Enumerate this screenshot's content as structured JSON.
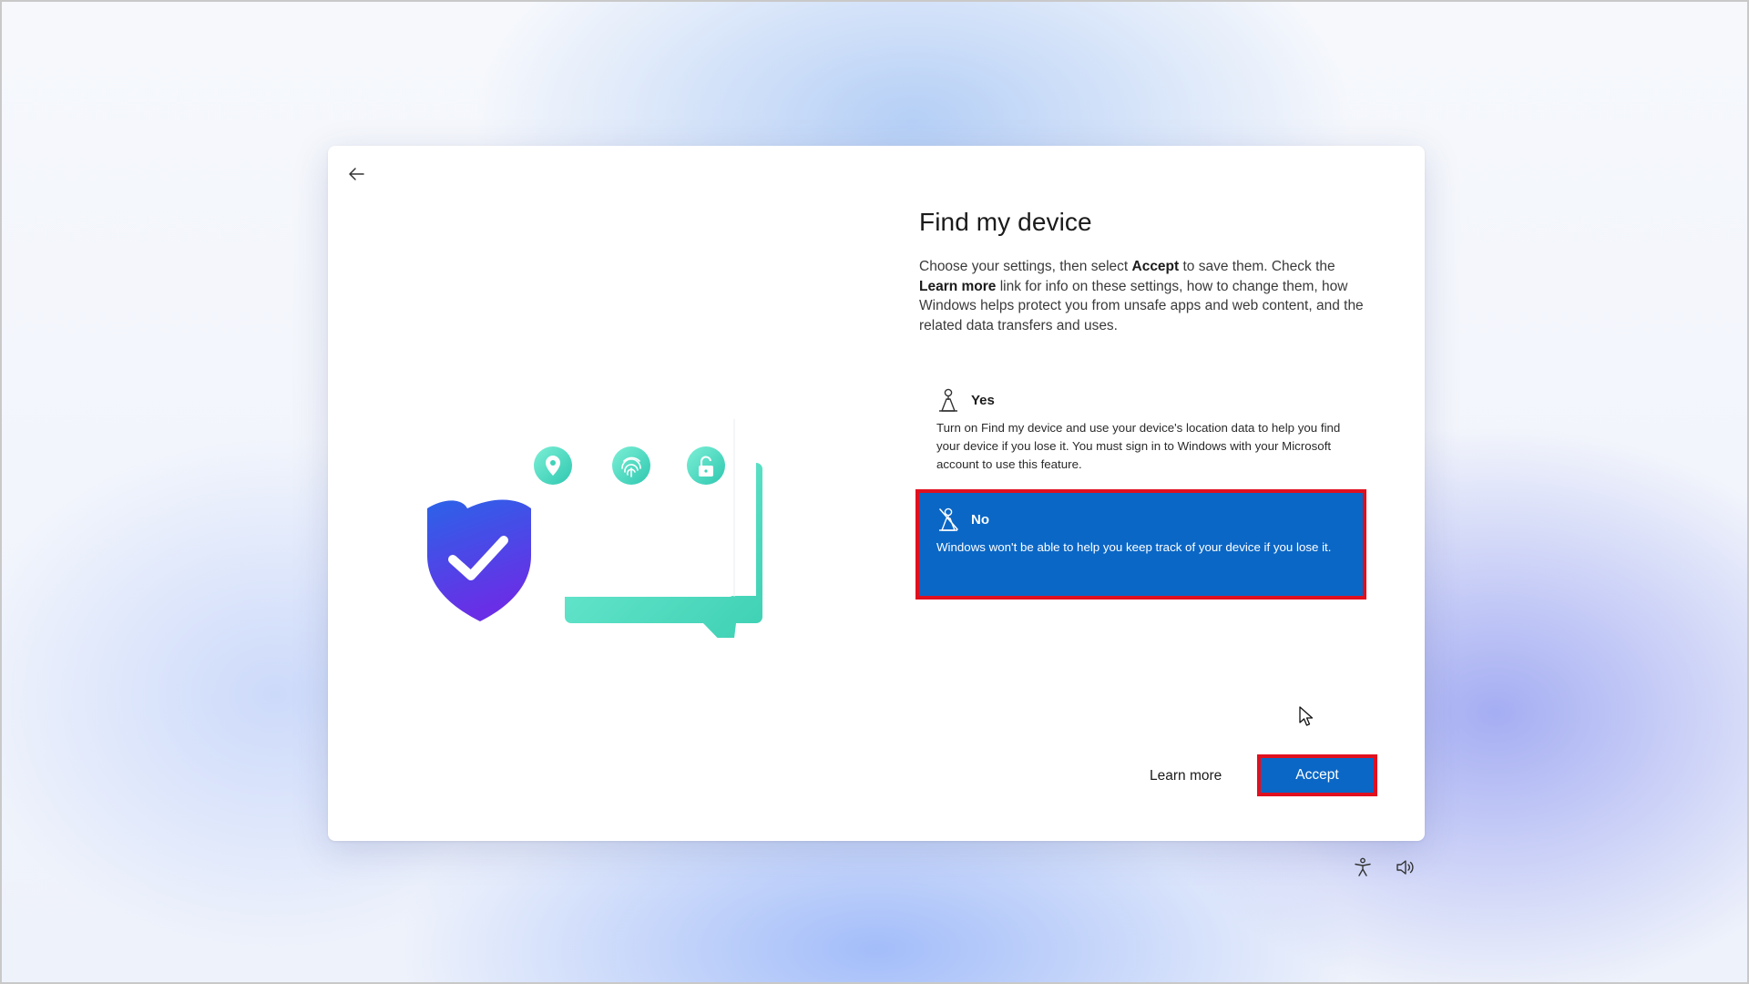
{
  "dialog": {
    "title": "Find my device",
    "description": {
      "p1": "Choose your settings, then select ",
      "accept_word": "Accept",
      "p2": " to save them. Check the ",
      "learn_more_word": "Learn more",
      "p3": " link for info on these settings, how to change them, how Windows helps protect you from unsafe apps and web content, and the related data transfers and uses."
    },
    "options": [
      {
        "label": "Yes",
        "icon": "person-location-icon",
        "text": "Turn on Find my device and use your device's location data to help you find your device if you lose it. You must sign in to Windows with your Microsoft account to use this feature.",
        "selected": false
      },
      {
        "label": "No",
        "icon": "person-location-off-icon",
        "text": "Windows won't be able to help you keep track of your device if you lose it.",
        "selected": true
      }
    ],
    "learn_more_label": "Learn more",
    "accept_label": "Accept"
  },
  "tray": {
    "icons": [
      "accessibility-icon",
      "volume-icon"
    ]
  },
  "colors": {
    "accent": "#0a67c6",
    "highlight_border": "#e0101f",
    "shield_top": "#2b63e8",
    "shield_bottom": "#6a2ee6",
    "teal": "#52dcc0"
  }
}
